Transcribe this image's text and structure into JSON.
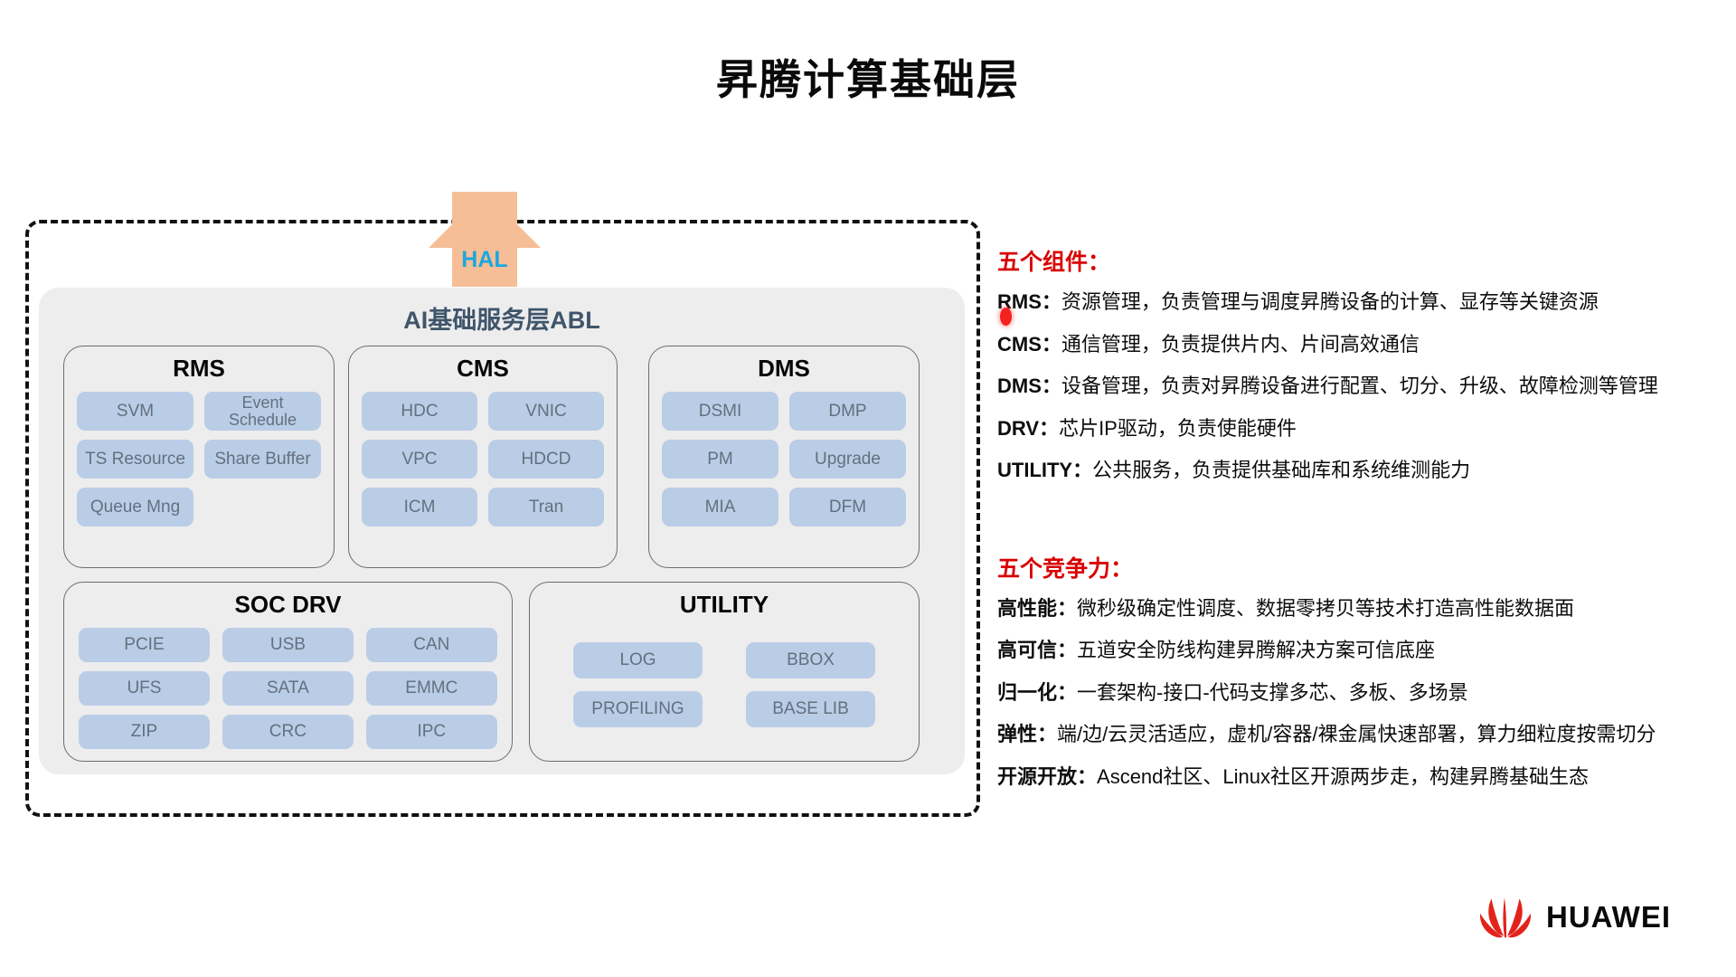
{
  "page": {
    "title": "昇腾计算基础层"
  },
  "diagram": {
    "hal_label": "HAL",
    "abl_title": "AI基础服务层ABL",
    "modules": [
      {
        "id": "rms",
        "title": "RMS",
        "chips": [
          "SVM",
          "Event Schedule",
          "TS Resource",
          "Share Buffer",
          "Queue Mng"
        ]
      },
      {
        "id": "cms",
        "title": "CMS",
        "chips": [
          "HDC",
          "VNIC",
          "VPC",
          "HDCD",
          "ICM",
          "Tran"
        ]
      },
      {
        "id": "dms",
        "title": "DMS",
        "chips": [
          "DSMI",
          "DMP",
          "PM",
          "Upgrade",
          "MIA",
          "DFM"
        ]
      },
      {
        "id": "soc",
        "title": "SOC DRV",
        "chips": [
          "PCIE",
          "USB",
          "CAN",
          "UFS",
          "SATA",
          "EMMC",
          "ZIP",
          "CRC",
          "IPC"
        ]
      },
      {
        "id": "utility",
        "title": "UTILITY",
        "chips": [
          "LOG",
          "BBOX",
          "PROFILING",
          "BASE LIB"
        ]
      }
    ]
  },
  "components_section": {
    "heading": "五个组件：",
    "items": [
      {
        "key": "RMS：",
        "desc": "资源管理，负责管理与调度昇腾设备的计算、显存等关键资源"
      },
      {
        "key": "CMS：",
        "desc": "通信管理，负责提供片内、片间高效通信"
      },
      {
        "key": "DMS：",
        "desc": "设备管理，负责对昇腾设备进行配置、切分、升级、故障检测等管理"
      },
      {
        "key": "DRV：",
        "desc": "芯片IP驱动，负责使能硬件"
      },
      {
        "key": "UTILITY：",
        "desc": "公共服务，负责提供基础库和系统维测能力"
      }
    ]
  },
  "competitiveness_section": {
    "heading": "五个竞争力：",
    "items": [
      {
        "key": "高性能：",
        "desc": "微秒级确定性调度、数据零拷贝等技术打造高性能数据面"
      },
      {
        "key": "高可信：",
        "desc": "五道安全防线构建昇腾解决方案可信底座"
      },
      {
        "key": "归一化：",
        "desc": "一套架构-接口-代码支撑多芯、多板、多场景"
      },
      {
        "key": "弹性：",
        "desc": "端/边/云灵活适应，虚机/容器/裸金属快速部署，算力细粒度按需切分"
      },
      {
        "key": "开源开放：",
        "desc": "Ascend社区、Linux社区开源两步走，构建昇腾基础生态"
      }
    ]
  },
  "brand": {
    "name": "HUAWEI",
    "logo_color": "#E2231A"
  },
  "colors": {
    "chip_fill": "#BACDE7",
    "chip_text": "#63707E",
    "panel_bg": "#EDEDED",
    "hal_arrow": "#F6BE96",
    "hal_text": "#1BA7E0",
    "abl_title": "#40556B",
    "heading_red": "#D90000"
  }
}
